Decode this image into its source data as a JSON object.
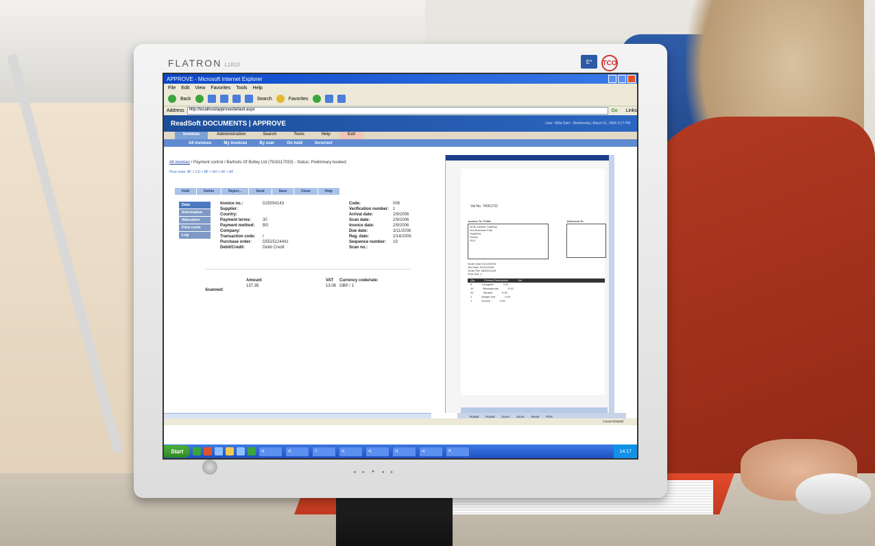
{
  "monitor": {
    "brand": "FLATRON",
    "brand_model": "L1810",
    "energy_logo": "energy-star",
    "tco_logo": "TCO"
  },
  "window": {
    "title": "APPROVE - Microsoft Internet Explorer"
  },
  "menu": [
    "File",
    "Edit",
    "View",
    "Favorites",
    "Tools",
    "Help"
  ],
  "toolbar": {
    "back": "Back",
    "search": "Search",
    "favorites": "Favorites"
  },
  "address": {
    "label": "Address",
    "url": "http://localhost/approve/default.aspx",
    "go": "Go",
    "links": "Links"
  },
  "app": {
    "title": "ReadSoft DOCUMENTS | APPROVE",
    "user": "User: Willa Dahl - Wednesday, March 01, 2006 3:17 PM",
    "tabs": [
      "Invoices",
      "Administration",
      "Search",
      "Tools",
      "Help",
      "Exit"
    ],
    "subtabs": [
      "All invoices",
      "My invoices",
      "By user",
      "On hold",
      "Incorrect"
    ]
  },
  "invoice": {
    "breadcrumb_link": "All invoices",
    "breadcrumb_rest": " / Payment control / Barfoots Of Botley Ltd (7916117033) - Status: Preliminary booked",
    "flow_route": "Flow route: AF > CU > BF > EH > AF > AF",
    "actions": [
      "Hold",
      "Delete",
      "Reject...",
      "Send",
      "Save",
      "Close",
      "Help"
    ],
    "nav": [
      "Data",
      "Information",
      "Allocation",
      "Flow route",
      "Log"
    ],
    "fields_left": [
      {
        "label": "Invoice no.:",
        "value": "D25054143"
      },
      {
        "label": "Supplier:",
        "value": ""
      },
      {
        "label": "Country:",
        "value": ""
      },
      {
        "label": "Payment terms:",
        "value": "30"
      },
      {
        "label": "Payment method:",
        "value": "BG"
      },
      {
        "label": "Company:",
        "value": ""
      },
      {
        "label": "Transaction code:",
        "value": "I"
      },
      {
        "label": "Purchase order:",
        "value": "D5525124441"
      },
      {
        "label": "Debit/Credit:",
        "value": "Debit   Credit"
      }
    ],
    "fields_right": [
      {
        "label": "Code:",
        "value": "006"
      },
      {
        "label": "Verification number:",
        "value": "1"
      },
      {
        "label": "Arrival date:",
        "value": "2/9/2006"
      },
      {
        "label": "Scan date:",
        "value": "2/9/2006"
      },
      {
        "label": "Invoice date:",
        "value": "2/9/2006"
      },
      {
        "label": "Due date:",
        "value": "3/11/2006"
      },
      {
        "label": "Reg. date:",
        "value": "2/14/2006"
      },
      {
        "label": "Sequence number:",
        "value": "19"
      },
      {
        "label": "Scan no.:",
        "value": ""
      }
    ],
    "amount_label": "Amount",
    "vat_label": "VAT",
    "currency_label": "Currency code/rate:",
    "scanned_label": "Scanned:",
    "scanned_amount": "137.35",
    "scanned_vat": "13.06",
    "scanned_currency": "GBP / 1"
  },
  "document_image": {
    "vat_no": "Vat No. 76061722",
    "invoice_to": "Invoice To",
    "invoice_to_code": "TY003",
    "delivered_to": "Delivered To",
    "address_lines": [
      "NCB Cantina Catering",
      "2nd Business Park",
      "Guildford",
      "Surrey",
      "GU1"
    ],
    "order_date": "Order Date 01/12/2006",
    "tax_date": "Tax Date: 09/12/2006",
    "order_ref": "Order Ref: 0825/12445",
    "pod_ref": "POD Ref: 1",
    "table_header": [
      "Qty",
      "Product Description",
      "Vat"
    ],
    "rows": [
      [
        "6",
        "Courgette",
        "0.00"
      ],
      [
        "10",
        "Beansprouts",
        "0.00"
      ],
      [
        "20",
        "Squash",
        "0.00"
      ],
      [
        "1",
        "Mange tout",
        "0.00"
      ],
      [
        "1",
        "Onions",
        "0.00"
      ]
    ],
    "footer_actions": [
      "Rotate",
      "Rotate",
      "Zoom",
      "Zoom",
      "Reset",
      "Print"
    ]
  },
  "status": {
    "zone": "Local intranet"
  },
  "taskbar": {
    "start": "Start",
    "clock": "14:17",
    "tasks": [
      "e]",
      "e]",
      "C",
      "e]",
      "e]",
      "e]",
      "e]",
      "B"
    ]
  }
}
